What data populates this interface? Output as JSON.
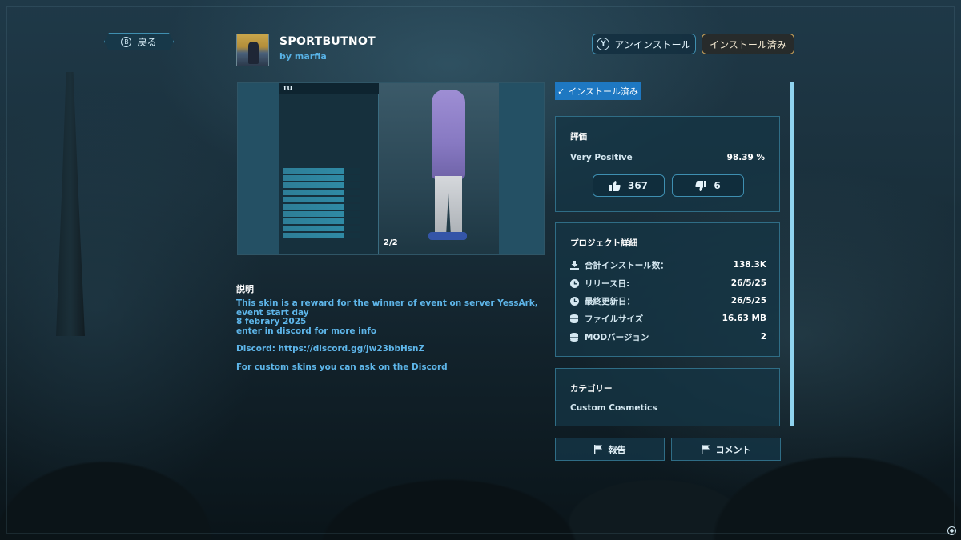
{
  "header": {
    "back_button": {
      "glyph": "B",
      "label": "戻る"
    },
    "mod": {
      "title": "SPORTBUTNOT",
      "author": "by marfia"
    },
    "uninstall_button": {
      "glyph": "Y",
      "label": "アンインストール"
    },
    "installed_button": {
      "label": "インストール済み"
    }
  },
  "preview": {
    "tab_label": "TU",
    "counter": "2/2"
  },
  "description": {
    "heading": "説明",
    "line1": "This skin is a reward for the winner of event on server YessArk, event start day\n8 febrary 2025\nenter in discord for more info",
    "line2": "Discord: https://discord.gg/jw23bbHsnZ",
    "line3": "For custom skins you can ask on the Discord"
  },
  "status_tag": {
    "check": "✓",
    "label": "インストール済み"
  },
  "rating": {
    "title": "評価",
    "label": "Very Positive",
    "percent": "98.39 %",
    "upvotes": "367",
    "downvotes": "6"
  },
  "details": {
    "title": "プロジェクト詳細",
    "rows": [
      {
        "icon": "download-icon",
        "label": "合計インストール数：",
        "value": "138.3K"
      },
      {
        "icon": "clock-icon",
        "label": "リリース日:",
        "value": "26/5/25"
      },
      {
        "icon": "clock-icon",
        "label": "最終更新日：",
        "value": "26/5/25"
      },
      {
        "icon": "database-icon",
        "label": "ファイルサイズ",
        "value": "16.63 MB"
      },
      {
        "icon": "database-icon",
        "label": "MODバージョン",
        "value": "2"
      }
    ]
  },
  "category": {
    "title": "カテゴリー",
    "value": "Custom Cosmetics"
  },
  "actions": {
    "report": "報告",
    "comment": "コメント"
  },
  "colors": {
    "accent_blue": "#1e78c2",
    "link_blue": "#5eb6ea",
    "installed_gold": "#c9a25a",
    "panel_border": "#2f6d86"
  }
}
